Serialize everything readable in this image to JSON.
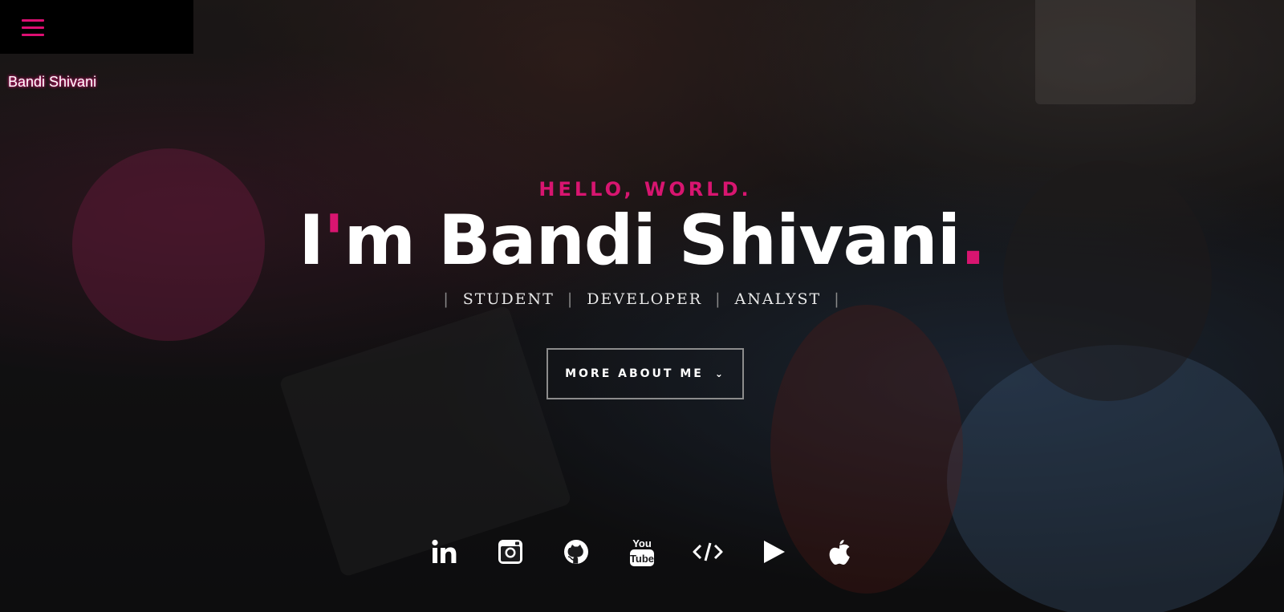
{
  "nav": {
    "menu_icon": "hamburger-icon",
    "brand": "Bandi Shivani",
    "accent_color": "#d81570"
  },
  "intro": {
    "greeting": "HELLO, WORLD.",
    "headline_prefix": "I",
    "headline_apostrophe": "'",
    "headline_name": "m Bandi Shivani",
    "headline_period": ".",
    "roles": [
      "STUDENT",
      "DEVELOPER",
      "ANALYST"
    ],
    "separator": "|"
  },
  "cta": {
    "label": "MORE ABOUT ME",
    "icon": "chevron-down-icon",
    "chevron": "⌄"
  },
  "socials": [
    {
      "name": "linkedin-icon"
    },
    {
      "name": "instagram-icon"
    },
    {
      "name": "github-icon"
    },
    {
      "name": "youtube-icon",
      "text_top": "You",
      "text_bottom": "Tube"
    },
    {
      "name": "code-icon"
    },
    {
      "name": "play-store-icon"
    },
    {
      "name": "apple-icon"
    }
  ]
}
